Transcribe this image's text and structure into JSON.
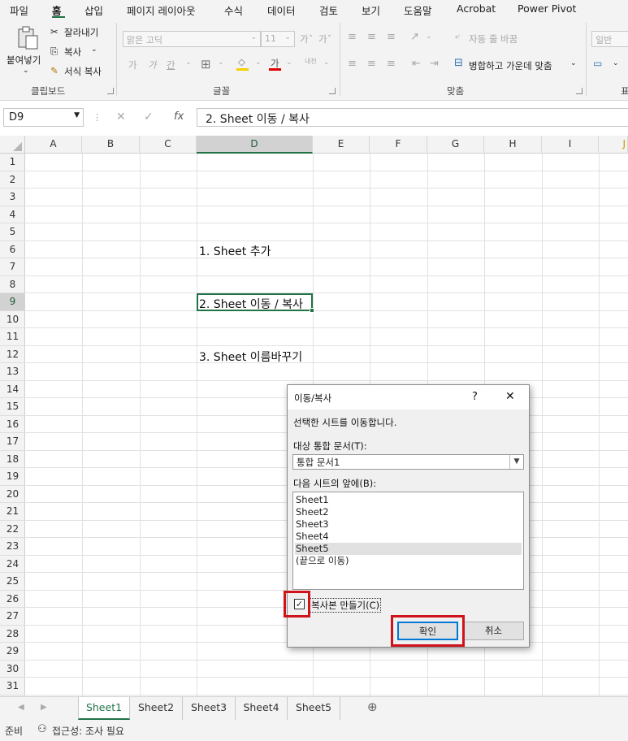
{
  "menubar": {
    "tabs": [
      "파일",
      "홈",
      "삽입",
      "페이지 레이아웃",
      "수식",
      "데이터",
      "검토",
      "보기",
      "도움말",
      "Acrobat",
      "Power Pivot"
    ]
  },
  "ribbon": {
    "clipboard": {
      "paste": "붙여넣기",
      "cut": "잘라내기",
      "copy": "복사",
      "format_painter": "서식 복사",
      "label": "클립보드"
    },
    "font": {
      "font_name": "맑은 고딕",
      "font_size": "11",
      "label": "글꼴",
      "bold": "가",
      "italic": "가",
      "underline": "간",
      "grow": "가ˆ",
      "shrink": "가ˇ",
      "phonetic": "내천",
      "font_color": "가"
    },
    "alignment": {
      "wrap": "자동 줄 바꿈",
      "merge": "병합하고 가운데 맞춤",
      "label": "맞춤"
    },
    "number": {
      "format": "일반",
      "label": "표"
    }
  },
  "formula_bar": {
    "name_box": "D9",
    "fx": "fx",
    "content": "2. Sheet 이동 / 복사"
  },
  "columns": [
    "A",
    "B",
    "C",
    "D",
    "E",
    "F",
    "G",
    "H",
    "I",
    "J"
  ],
  "rows": [
    "1",
    "2",
    "3",
    "4",
    "5",
    "6",
    "7",
    "8",
    "9",
    "10",
    "11",
    "12",
    "13",
    "14",
    "15",
    "16",
    "17",
    "18",
    "19",
    "20",
    "21",
    "22",
    "23",
    "24",
    "25",
    "26",
    "27",
    "28",
    "29",
    "30",
    "31"
  ],
  "cells": {
    "D6": "1. Sheet 추가",
    "D9": "2. Sheet 이동 / 복사",
    "D12": "3. Sheet 이름바꾸기"
  },
  "sheet_tabs": [
    "Sheet1",
    "Sheet2",
    "Sheet3",
    "Sheet4",
    "Sheet5"
  ],
  "active_sheet": "Sheet1",
  "status": {
    "ready": "준비",
    "accessibility": "접근성: 조사 필요"
  },
  "dialog": {
    "title": "이동/복사",
    "help": "?",
    "close": "✕",
    "instruction": "선택한 시트를 이동합니다.",
    "target_label": "대상 통합 문서(T):",
    "target_value": "통합 문서1",
    "before_label": "다음 시트의 앞에(B):",
    "list": [
      "Sheet1",
      "Sheet2",
      "Sheet3",
      "Sheet4",
      "Sheet5",
      "(끝으로 이동)"
    ],
    "selected_item": "Sheet5",
    "copy_label": "복사본 만들기(C)",
    "copy_checked": true,
    "ok": "확인",
    "cancel": "취소"
  },
  "colors": {
    "accent": "#217346",
    "highlight": "#d0121b",
    "dialog_default": "#0078d7"
  }
}
